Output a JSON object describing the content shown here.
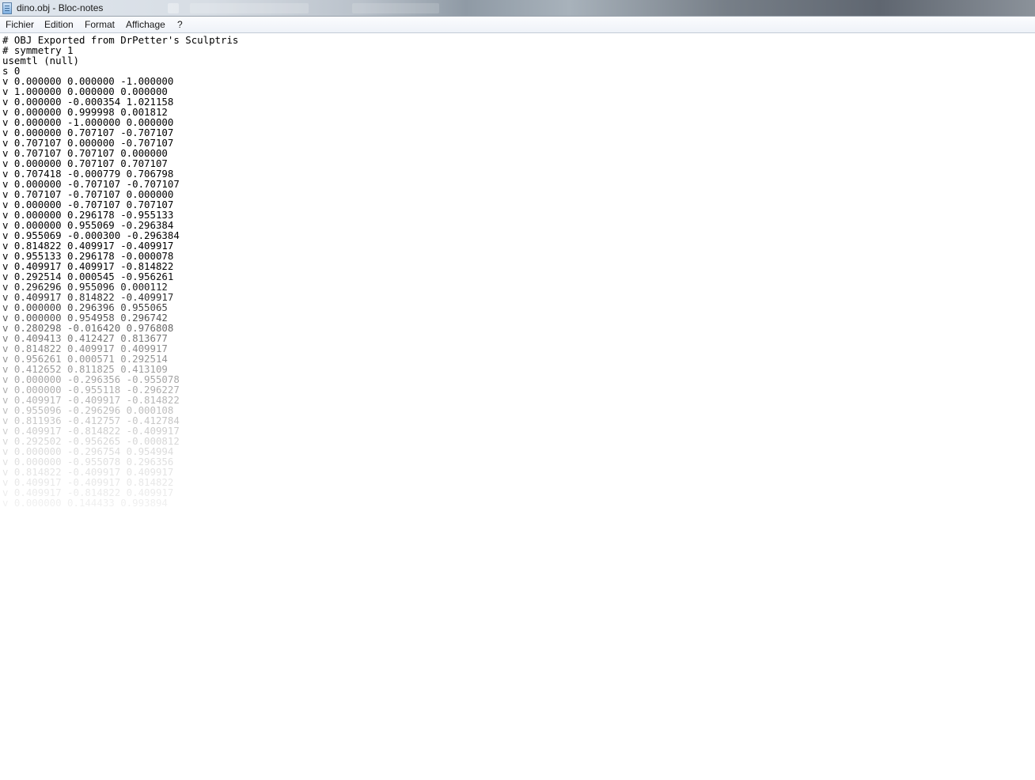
{
  "window": {
    "title": "dino.obj - Bloc-notes",
    "app_icon": "notepad-icon"
  },
  "menu": {
    "items": [
      "Fichier",
      "Edition",
      "Format",
      "Affichage",
      "?"
    ]
  },
  "document": {
    "lines": [
      "# OBJ Exported from DrPetter's Sculptris",
      "# symmetry 1",
      "usemtl (null)",
      "s 0",
      "v 0.000000 0.000000 -1.000000",
      "v 1.000000 0.000000 0.000000",
      "v 0.000000 -0.000354 1.021158",
      "v 0.000000 0.999998 0.001812",
      "v 0.000000 -1.000000 0.000000",
      "v 0.000000 0.707107 -0.707107",
      "v 0.707107 0.000000 -0.707107",
      "v 0.707107 0.707107 0.000000",
      "v 0.000000 0.707107 0.707107",
      "v 0.707418 -0.000779 0.706798",
      "v 0.000000 -0.707107 -0.707107",
      "v 0.707107 -0.707107 0.000000",
      "v 0.000000 -0.707107 0.707107",
      "v 0.000000 0.296178 -0.955133",
      "v 0.000000 0.955069 -0.296384",
      "v 0.955069 -0.000300 -0.296384",
      "v 0.814822 0.409917 -0.409917",
      "v 0.955133 0.296178 -0.000078",
      "v 0.409917 0.409917 -0.814822",
      "v 0.292514 0.000545 -0.956261",
      "v 0.296296 0.955096 0.000112",
      "v 0.409917 0.814822 -0.409917",
      "v 0.000000 0.296396 0.955065",
      "v 0.000000 0.954958 0.296742",
      "v 0.280298 -0.016420 0.976808",
      "v 0.409413 0.412427 0.813677",
      "v 0.814822 0.409917 0.409917",
      "v 0.956261 0.000571 0.292514",
      "v 0.412652 0.811825 0.413109",
      "v 0.000000 -0.296356 -0.955078",
      "v 0.000000 -0.955118 -0.296227",
      "v 0.409917 -0.409917 -0.814822",
      "v 0.955096 -0.296296 0.000108",
      "v 0.811936 -0.412757 -0.412784",
      "v 0.409917 -0.814822 -0.409917",
      "v 0.292502 -0.956265 -0.000812",
      "v 0.000000 -0.296754 0.954994",
      "v 0.000000 -0.955078 0.296356",
      "v 0.814822 -0.409917 0.409917",
      "v 0.409917 -0.409917 0.814822",
      "v 0.409917 -0.814822 0.409917",
      "v 0.000000 0.144433 0.993894"
    ]
  }
}
